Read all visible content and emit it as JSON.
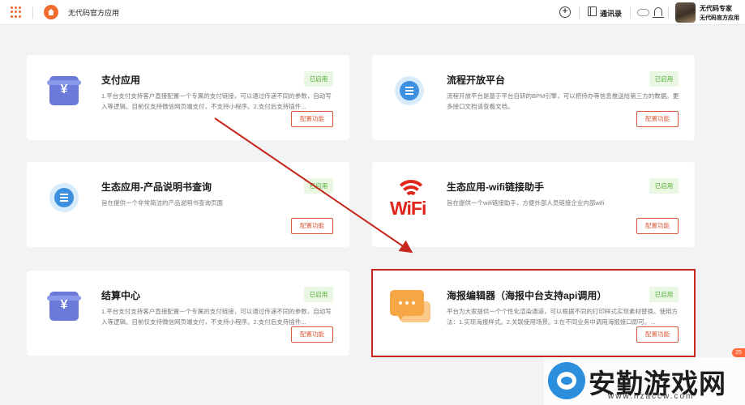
{
  "app": {
    "title": "无代码官方应用"
  },
  "toolbar": {
    "contacts_label": "通讯录"
  },
  "user": {
    "name": "无代码专家",
    "org": "无代码官方应用"
  },
  "cards": [
    {
      "title": "支付应用",
      "status": "已启用",
      "desc": "1.平台支付支持客户直接配置一个专属的支付链接，可以通过传递不同的参数，自动写入等逻辑。目前仅支持微信网页端支付，不支持小程序。2.支付后支持插件...",
      "button": "配置功能",
      "icon": "wallet-icon"
    },
    {
      "title": "流程开放平台",
      "status": "已启用",
      "desc": "流程开放平台是基于平台自研的BPM引擎，可以把待办等信息推送给第三方的数据。更多接口文档请查看文档。",
      "button": "配置功能",
      "icon": "list-circle-icon"
    },
    {
      "title": "生态应用-产品说明书查询",
      "status": "已启用",
      "desc": "旨在提供一个非常简洁的产品说明书查询页面",
      "button": "配置功能",
      "icon": "list-circle-icon"
    },
    {
      "title": "生态应用-wifi链接助手",
      "status": "已启用",
      "desc": "旨在提供一个wifi链接助手，方便外部人员链接企业内部wifi",
      "button": "配置功能",
      "icon": "wifi-icon"
    },
    {
      "title": "结算中心",
      "status": "已启用",
      "desc": "1.平台支付支持客户直接配置一个专属的支付链接，可以通过传递不同的参数，自动写入等逻辑。目前仅支持微信网页端支付，不支持小程序。2.支付后支持插件...",
      "button": "配置功能",
      "icon": "wallet-icon"
    },
    {
      "title": "海报编辑器（海报中台支持api调用）",
      "status": "已启用",
      "desc": "平台为大家提供一个个性化渲染通道，可以根据不同的打印样式实现素材替换。使用方法：1.实现海报样式。2.关联使用场景。3.在不同业务中调用海报接口即可。...",
      "button": "配置功能",
      "icon": "chat-icon"
    }
  ],
  "wifi_logo_text": "WiFi",
  "watermark": {
    "text": "安勤游戏网",
    "url": "www.hzaccw.com"
  },
  "corner_badge": "25",
  "colors": {
    "accent": "#f06a2a",
    "status_green": "#4fae34",
    "button_red": "#d9583a",
    "highlight": "#c6281d"
  }
}
